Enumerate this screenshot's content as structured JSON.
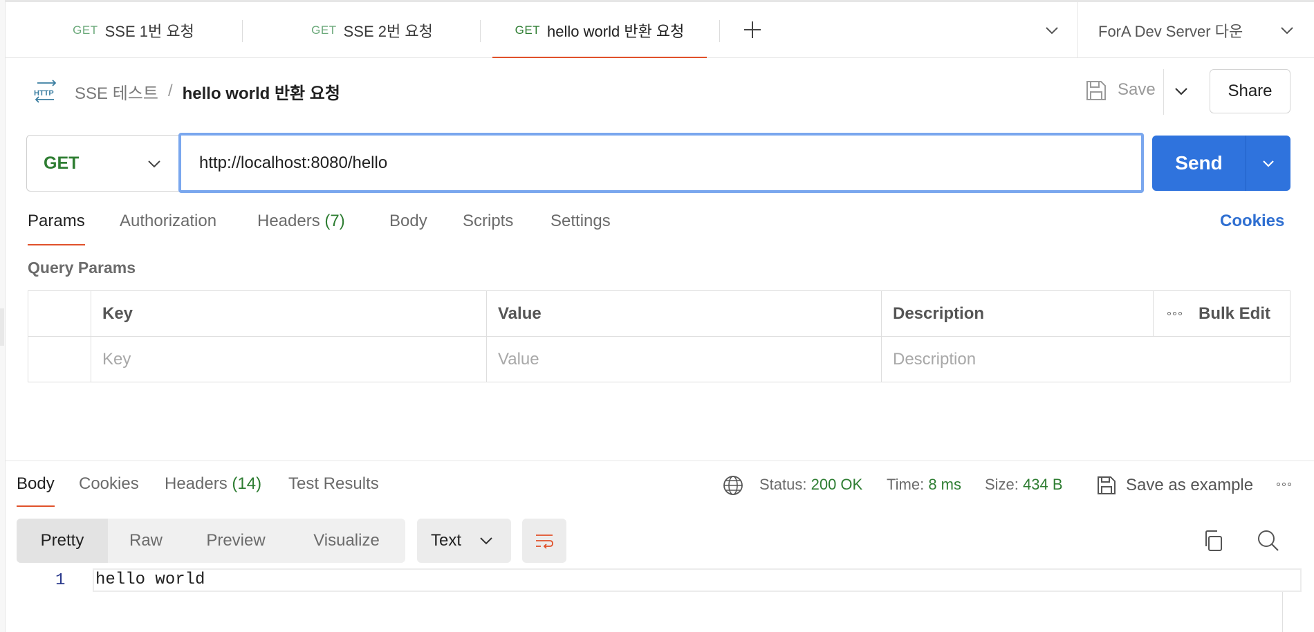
{
  "tabs": [
    {
      "method": "GET",
      "label": "SSE 1번 요청",
      "active": false
    },
    {
      "method": "GET",
      "label": "SSE 2번 요청",
      "active": false
    },
    {
      "method": "GET",
      "label": "hello world 반환 요청",
      "active": true
    }
  ],
  "environment": {
    "label": "ForA Dev Server 다운"
  },
  "breadcrumb": {
    "parent": "SSE 테스트",
    "separator": "/",
    "current": "hello world 반환 요청"
  },
  "toolbar": {
    "save_label": "Save",
    "share_label": "Share"
  },
  "request": {
    "method": "GET",
    "url": "http://localhost:8080/hello",
    "send_label": "Send"
  },
  "request_tabs": {
    "params": "Params",
    "authorization": "Authorization",
    "headers": "Headers",
    "headers_count": "(7)",
    "body": "Body",
    "scripts": "Scripts",
    "settings": "Settings",
    "cookies": "Cookies"
  },
  "query_params": {
    "title": "Query Params",
    "columns": {
      "key": "Key",
      "value": "Value",
      "description": "Description",
      "bulk_edit": "Bulk Edit"
    },
    "placeholders": {
      "key": "Key",
      "value": "Value",
      "description": "Description"
    }
  },
  "response_tabs": {
    "body": "Body",
    "cookies": "Cookies",
    "headers": "Headers",
    "headers_count": "(14)",
    "test_results": "Test Results"
  },
  "response_status": {
    "status_label": "Status:",
    "status_value": "200 OK",
    "time_label": "Time:",
    "time_value": "8 ms",
    "size_label": "Size:",
    "size_value": "434 B",
    "save_example": "Save as example"
  },
  "body_view": {
    "modes": [
      "Pretty",
      "Raw",
      "Preview",
      "Visualize"
    ],
    "active_mode": "Pretty",
    "format": "Text"
  },
  "response_body": {
    "lines": [
      {
        "no": "1",
        "text": "hello world"
      }
    ]
  },
  "colors": {
    "accent": "#e0512a",
    "send": "#2f73dd",
    "method_get": "#2e7d32",
    "link": "#2f6fd1"
  }
}
